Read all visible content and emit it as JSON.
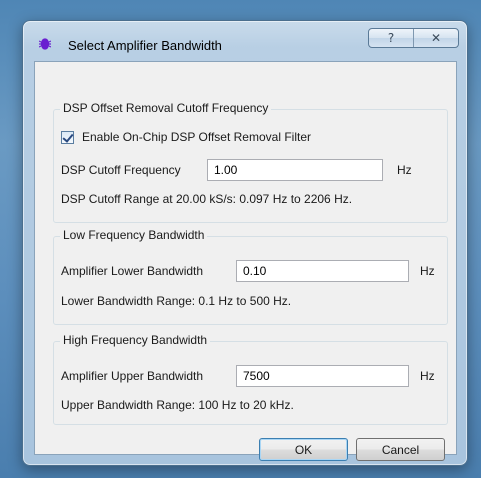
{
  "window": {
    "title": "Select Amplifier Bandwidth",
    "help_glyph": "?",
    "close_glyph": "✕"
  },
  "dsp_group": {
    "title": "DSP Offset Removal Cutoff Frequency",
    "enable_checkbox": {
      "label": "Enable On-Chip DSP Offset Removal Filter",
      "checked": true
    },
    "cutoff_label": "DSP Cutoff Frequency",
    "cutoff_value": "1.00",
    "cutoff_unit": "Hz",
    "range_text": "DSP Cutoff Range at 20.00 kS/s: 0.097 Hz to 2206 Hz."
  },
  "low_group": {
    "title": "Low Frequency Bandwidth",
    "lower_label": "Amplifier Lower Bandwidth",
    "lower_value": "0.10",
    "lower_unit": "Hz",
    "range_text": "Lower Bandwidth Range: 0.1 Hz to 500 Hz."
  },
  "high_group": {
    "title": "High Frequency Bandwidth",
    "upper_label": "Amplifier Upper Bandwidth",
    "upper_value": "7500",
    "upper_unit": "Hz",
    "range_text": "Upper Bandwidth Range: 100 Hz to 20 kHz."
  },
  "buttons": {
    "ok": "OK",
    "cancel": "Cancel"
  }
}
